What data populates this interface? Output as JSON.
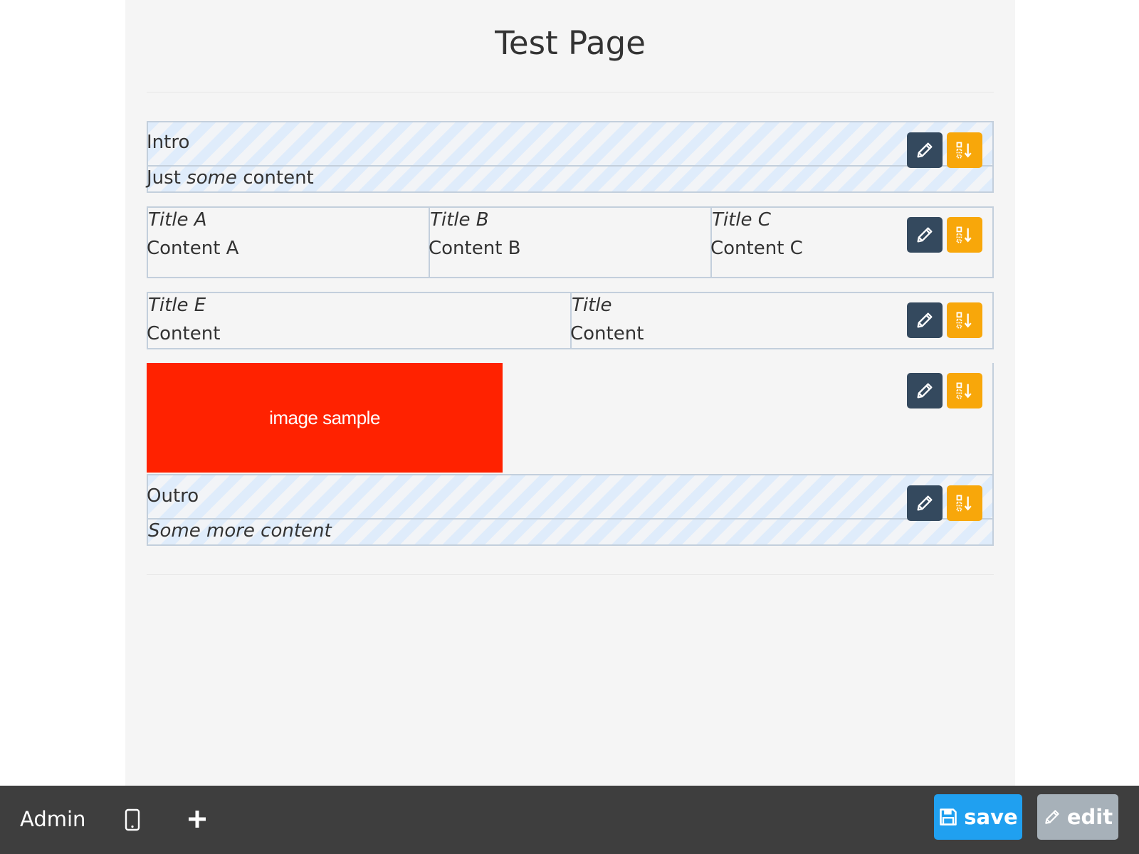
{
  "page": {
    "title": "Test Page"
  },
  "blocks": {
    "intro": {
      "title": "Intro",
      "content_prefix": "Just ",
      "content_emphasis": "some",
      "content_suffix": " content"
    },
    "three_columns": [
      {
        "title": "Title A",
        "content": "Content A"
      },
      {
        "title": "Title B",
        "content": "Content B"
      },
      {
        "title": "Title C",
        "content": "Content C"
      }
    ],
    "two_columns": [
      {
        "title": "Title E",
        "content": "Content"
      },
      {
        "title": "Title",
        "content": "Content"
      }
    ],
    "image": {
      "caption": "image sample",
      "background_color": "#ff2200"
    },
    "outro": {
      "title": "Outro",
      "content": "Some more content"
    }
  },
  "tools": {
    "edit_icon": "pencil-icon",
    "move_icon": "reorder-icon",
    "edit_color": "#34495e",
    "move_color": "#f8a70a"
  },
  "admin_bar": {
    "label": "Admin",
    "device_icon": "tablet-icon",
    "add_icon": "plus-icon",
    "save_label": "save",
    "save_icon": "floppy-disk-icon",
    "edit_label": "edit",
    "edit_icon": "pencil-icon",
    "save_color": "#20a0f0",
    "edit_color": "#a7b1b9"
  }
}
